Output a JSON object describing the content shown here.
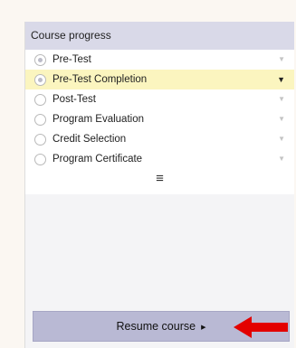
{
  "course_progress": {
    "title": "Course progress",
    "items": [
      {
        "label": "Pre-Test",
        "selected": true,
        "highlighted": false
      },
      {
        "label": "Pre-Test Completion",
        "selected": true,
        "highlighted": true
      },
      {
        "label": "Post-Test",
        "selected": false,
        "highlighted": false
      },
      {
        "label": "Program Evaluation",
        "selected": false,
        "highlighted": false
      },
      {
        "label": "Credit Selection",
        "selected": false,
        "highlighted": false
      },
      {
        "label": "Program Certificate",
        "selected": false,
        "highlighted": false
      }
    ],
    "menu_icon": "hamburger-icon"
  },
  "resume": {
    "label": "Resume course",
    "arrow_icon": "caret-right-icon",
    "pointer_color": "#e30000"
  }
}
